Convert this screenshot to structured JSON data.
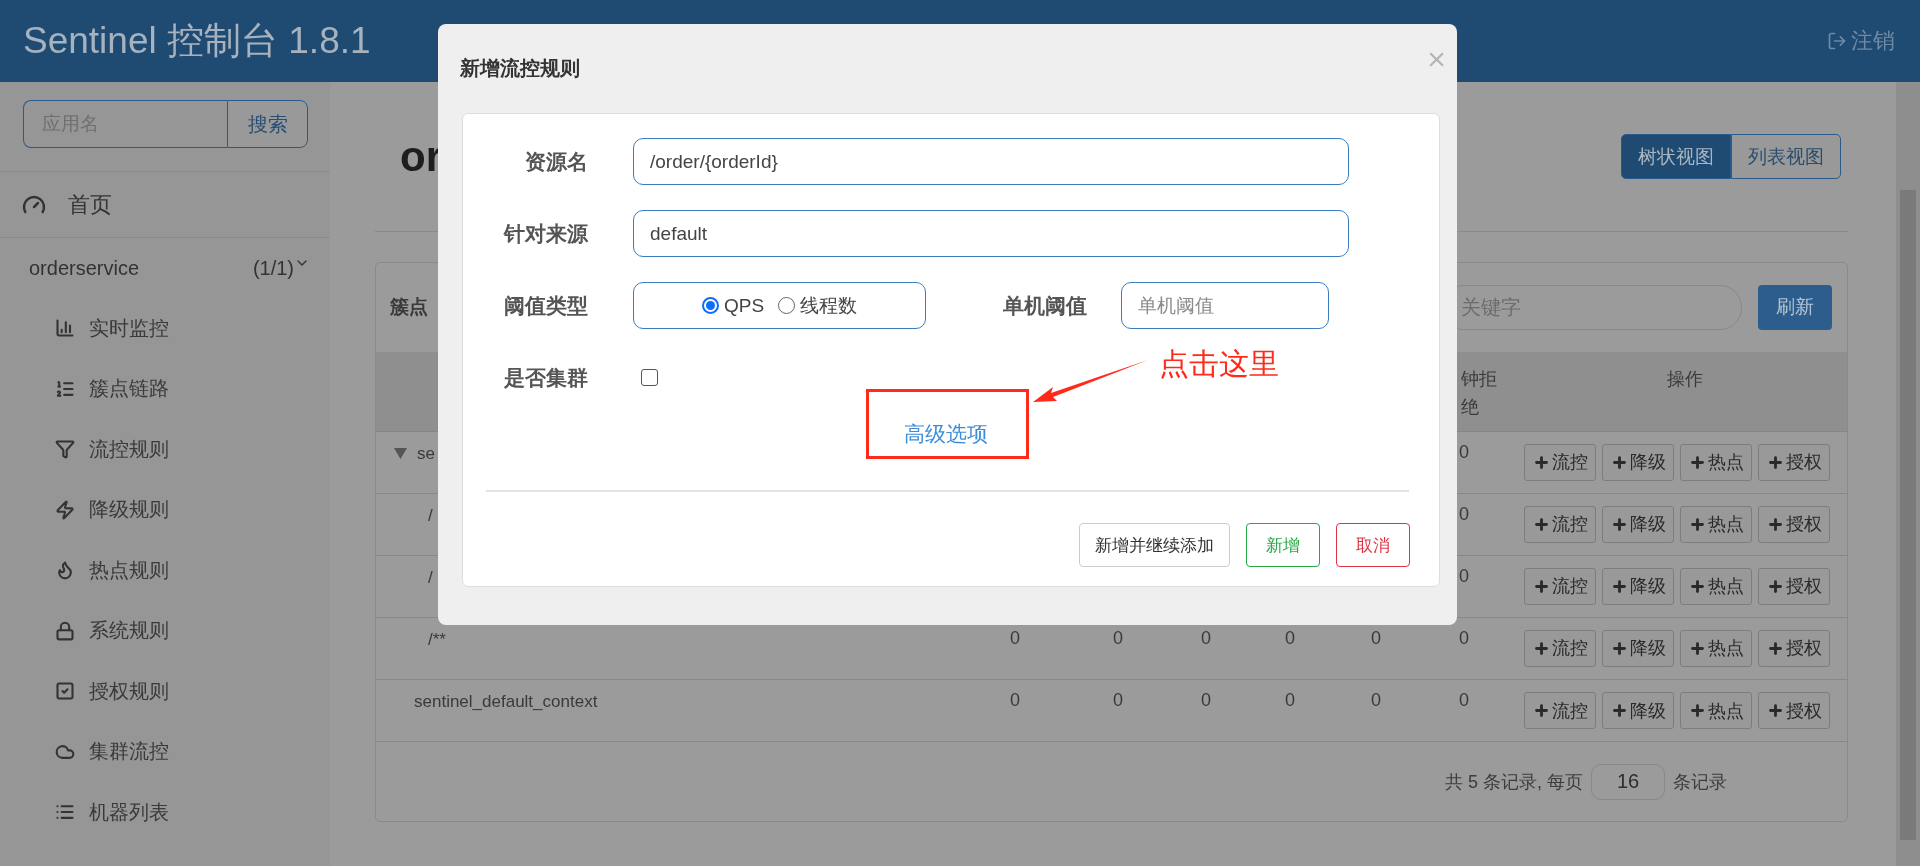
{
  "header": {
    "title": "Sentinel 控制台 1.8.1",
    "logout": "注销"
  },
  "sidebar": {
    "search": {
      "placeholder": "应用名",
      "button": "搜索"
    },
    "home": "首页",
    "app": {
      "name": "orderservice",
      "count": "(1/1)",
      "expanded": true
    },
    "items": [
      {
        "label": "实时监控",
        "selected": false
      },
      {
        "label": "簇点链路",
        "selected": false
      },
      {
        "label": "流控规则",
        "selected": false
      },
      {
        "label": "降级规则",
        "selected": false
      },
      {
        "label": "热点规则",
        "selected": false
      },
      {
        "label": "系统规则",
        "selected": false
      },
      {
        "label": "授权规则",
        "selected": false
      },
      {
        "label": "集群流控",
        "selected": false
      },
      {
        "label": "机器列表",
        "selected": false
      }
    ]
  },
  "content": {
    "heading": "or",
    "views": [
      {
        "label": "树状视图",
        "selected": true
      },
      {
        "label": "列表视图",
        "selected": false
      }
    ]
  },
  "table": {
    "title": "簇点",
    "search": {
      "placeholder": "关键字"
    },
    "refresh": "刷新",
    "columns": [
      {
        "label": "钟拒绝"
      },
      {
        "label": "操作"
      }
    ],
    "rows": [
      {
        "name": "se",
        "expanded": true,
        "cells": [
          "0"
        ],
        "actions": [
          "流控",
          "降级",
          "热点",
          "授权"
        ],
        "children": [
          {
            "name": "/",
            "cells": [
              "0"
            ],
            "actions": [
              "流控",
              "降级",
              "热点",
              "授权"
            ]
          },
          {
            "name": "/",
            "cells": [
              "0"
            ],
            "actions": [
              "流控",
              "降级",
              "热点",
              "授权"
            ]
          },
          {
            "name": "/**",
            "cells": [
              "0",
              "0",
              "0",
              "0",
              "0",
              "0"
            ],
            "actions": [
              "流控",
              "降级",
              "热点",
              "授权"
            ]
          }
        ]
      },
      {
        "name": "sentinel_default_context",
        "expanded": false,
        "cells": [
          "0",
          "0",
          "0",
          "0",
          "0",
          "0"
        ],
        "actions": [
          "流控",
          "降级",
          "热点",
          "授权"
        ]
      }
    ],
    "pagination": {
      "before": "共 5 条记录, 每页",
      "page_size": "16",
      "after": "条记录"
    }
  },
  "dialog": {
    "title": "新增流控规则",
    "close": "×",
    "fields": [
      {
        "kind": "text",
        "label": "资源名",
        "value": "/order/{orderId}"
      },
      {
        "kind": "text",
        "label": "针对来源",
        "value": "default"
      },
      {
        "kind": "threshold",
        "label": "阈值类型",
        "options": [
          {
            "label": "QPS",
            "selected": true
          },
          {
            "label": "线程数",
            "selected": false
          }
        ],
        "side_label": "单机阈值",
        "side_placeholder": "单机阈值"
      },
      {
        "kind": "checkbox",
        "label": "是否集群",
        "checked": false
      }
    ],
    "advanced": "高级选项",
    "annotation": {
      "text": "点击这里"
    },
    "buttons": [
      {
        "kind": "default",
        "label": "新增并继续添加"
      },
      {
        "kind": "success",
        "label": "新增"
      },
      {
        "kind": "danger",
        "label": "取消"
      }
    ]
  }
}
